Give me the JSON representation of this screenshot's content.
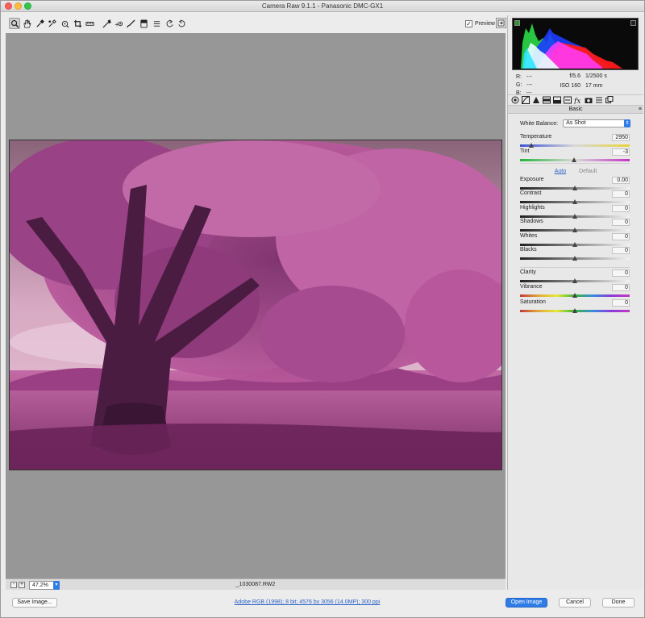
{
  "window": {
    "title": "Camera Raw 9.1.1  -  Panasonic DMC-GX1"
  },
  "colors": {
    "accent": "#2f7ce6",
    "canvas": "#979797",
    "photo_tint": "#c069a6"
  },
  "toolbar": {
    "tools": [
      {
        "name": "zoom-tool-icon",
        "selected": true
      },
      {
        "name": "hand-tool-icon"
      },
      {
        "name": "white-balance-tool-icon"
      },
      {
        "name": "color-sampler-tool-icon"
      },
      {
        "name": "targeted-adjustment-tool-icon"
      },
      {
        "name": "crop-tool-icon"
      },
      {
        "name": "straighten-tool-icon"
      },
      {
        "name": "spot-removal-tool-icon"
      },
      {
        "name": "red-eye-tool-icon"
      },
      {
        "name": "adjustment-brush-icon"
      },
      {
        "name": "graduated-filter-icon"
      },
      {
        "name": "radial-filter-icon"
      },
      {
        "name": "preferences-icon"
      },
      {
        "name": "rotate-ccw-icon"
      },
      {
        "name": "rotate-cw-icon"
      }
    ],
    "preview_label": "Preview",
    "preview_checked": true
  },
  "status": {
    "zoom": "47.2%",
    "filename": "_1030087.RW2"
  },
  "info": {
    "r_label": "R:",
    "r_value": "---",
    "g_label": "G:",
    "g_value": "---",
    "b_label": "B:",
    "b_value": "---",
    "aperture": "f/5.6",
    "shutter": "1/2500 s",
    "iso": "ISO 160",
    "focal": "17 mm"
  },
  "panel": {
    "title": "Basic",
    "wb_label": "White Balance:",
    "wb_value": "As Shot",
    "auto_label": "Auto",
    "default_label": "Default",
    "sliders": [
      {
        "key": "temperature",
        "label": "Temperature",
        "value": "2950",
        "fraction": 0.1,
        "track": "temp"
      },
      {
        "key": "tint",
        "label": "Tint",
        "value": "-3",
        "fraction": 0.49,
        "track": "tint"
      },
      {
        "key": "exposure",
        "label": "Exposure",
        "value": "0.00",
        "fraction": 0.5,
        "track": "plain"
      },
      {
        "key": "contrast",
        "label": "Contrast",
        "value": "0",
        "fraction": 0.5,
        "track": "plain"
      },
      {
        "key": "highlights",
        "label": "Highlights",
        "value": "0",
        "fraction": 0.5,
        "track": "plain"
      },
      {
        "key": "shadows",
        "label": "Shadows",
        "value": "0",
        "fraction": 0.5,
        "track": "plain"
      },
      {
        "key": "whites",
        "label": "Whites",
        "value": "0",
        "fraction": 0.5,
        "track": "plain"
      },
      {
        "key": "blacks",
        "label": "Blacks",
        "value": "0",
        "fraction": 0.5,
        "track": "plain"
      },
      {
        "key": "clarity",
        "label": "Clarity",
        "value": "0",
        "fraction": 0.5,
        "track": "plain"
      },
      {
        "key": "vibrance",
        "label": "Vibrance",
        "value": "0",
        "fraction": 0.5,
        "track": "rainbow"
      },
      {
        "key": "saturation",
        "label": "Saturation",
        "value": "0",
        "fraction": 0.5,
        "track": "rainbow"
      }
    ]
  },
  "bottom": {
    "save_label": "Save Image...",
    "workflow_link": "Adobe RGB (1998); 8 bit; 4576 by 3056 (14.0MP); 300 ppi",
    "open_label": "Open Image",
    "cancel_label": "Cancel",
    "done_label": "Done"
  }
}
